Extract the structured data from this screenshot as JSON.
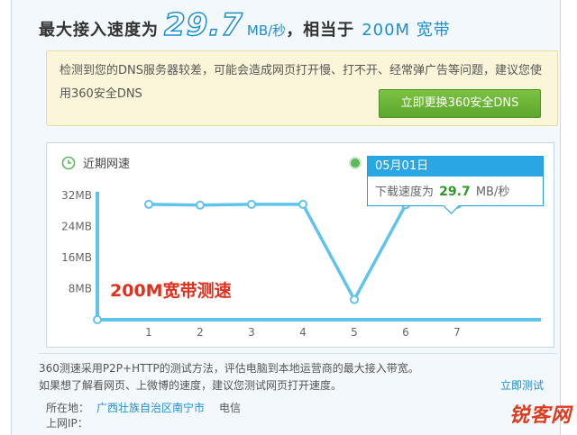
{
  "header": {
    "label_prefix": "最大接入速度为",
    "speed_value": "29.7",
    "speed_unit": "MB/秒",
    "equiv_label": "，相当于",
    "bandwidth": "200M 宽带"
  },
  "warning": {
    "text": "检测到您的DNS服务器较差，可能会造成网页打开慢、打不开、经常弹广告等问题，建议您使用360安全DNS",
    "button_label": "立即更换360安全DNS"
  },
  "recent": {
    "title": "近期网速",
    "tooltip_date": "05月01日",
    "tooltip_label": "下载速度为",
    "tooltip_value": "29.7",
    "tooltip_unit": "MB/秒"
  },
  "overlay_text": "200M宽带测速",
  "chart_data": {
    "type": "line",
    "title": "近期网速",
    "x": [
      1,
      2,
      3,
      4,
      5,
      6,
      7
    ],
    "y_tick_labels": [
      "8MB",
      "16MB",
      "24MB",
      "32MB"
    ],
    "ylim": [
      0,
      32
    ],
    "series": [
      {
        "values": [
          29.7,
          29.5,
          29.7,
          29.7,
          5.2,
          29.6,
          29.7
        ]
      }
    ],
    "grid": false,
    "line_color": "#5fc4ec"
  },
  "info": {
    "line1": "360测速采用P2P+HTTP的测试方法，评估电脑到本地运营商的最大接入带宽。",
    "line2": "如果想了解看网页、上微博的速度，建议您测试网页打开速度。",
    "retest": "立即测试",
    "location_label": "所在地：",
    "location_value": "广西壮族自治区南宁市",
    "isp": "电信",
    "ip_label": "上网IP："
  },
  "watermark": {
    "text": "锐客网"
  }
}
